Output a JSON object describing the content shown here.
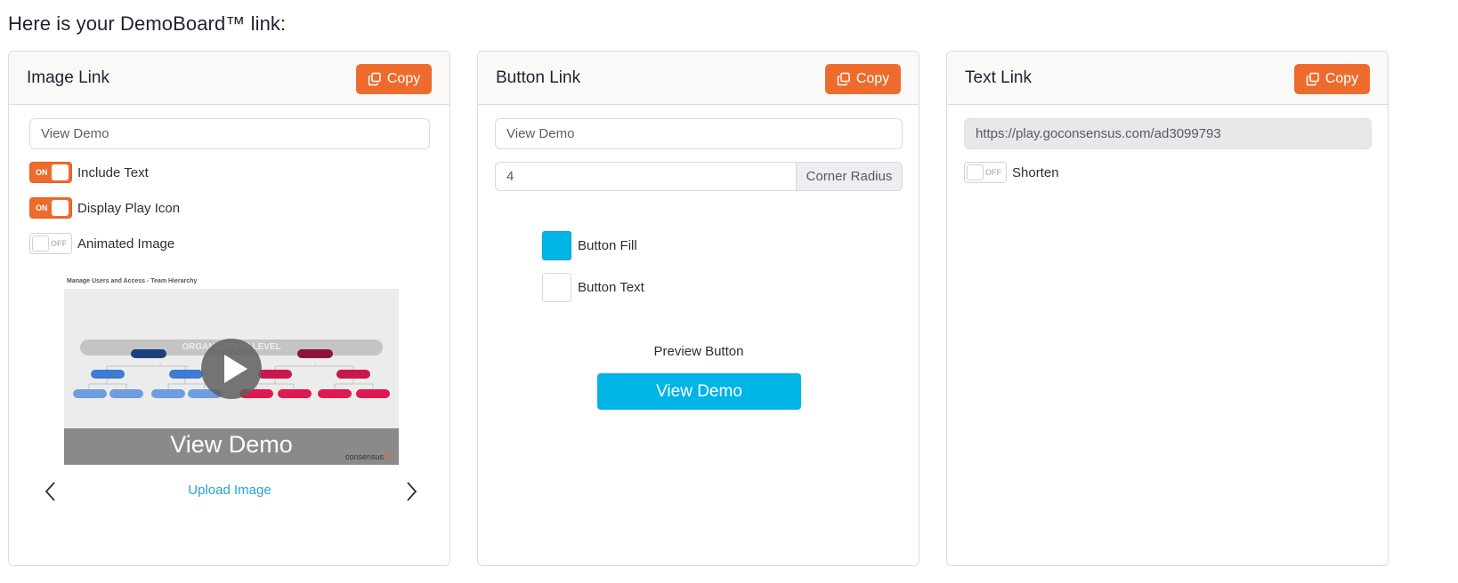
{
  "heading": "Here is your DemoBoard™ link:",
  "copy_label": "Copy",
  "colors": {
    "accent": "#ee6b2e",
    "button_fill": "#00b4e6",
    "button_text": "#ffffff",
    "link": "#24a4d8"
  },
  "image_link": {
    "title": "Image Link",
    "text_value": "View Demo",
    "include_text": {
      "label": "Include Text",
      "state": "ON"
    },
    "display_play_icon": {
      "label": "Display Play Icon",
      "state": "ON"
    },
    "animated_image": {
      "label": "Animated Image",
      "state": "OFF"
    },
    "thumbnail": {
      "caption": "Manage Users and Access - Team Hierarchy",
      "banner": "ORGANIZATION LEVEL",
      "overlay_text": "View Demo",
      "brand": "consensus"
    },
    "upload_label": "Upload Image"
  },
  "button_link": {
    "title": "Button Link",
    "text_value": "View Demo",
    "corner_radius_value": "4",
    "corner_radius_label": "Corner Radius",
    "fill_label": "Button Fill",
    "text_label": "Button Text",
    "preview_label": "Preview Button",
    "preview_text": "View Demo"
  },
  "text_link": {
    "title": "Text Link",
    "url": "https://play.goconsensus.com/ad3099793",
    "shorten": {
      "label": "Shorten",
      "state": "OFF"
    }
  }
}
